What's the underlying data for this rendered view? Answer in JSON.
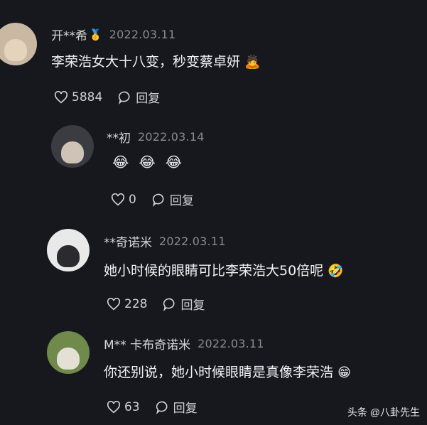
{
  "comments": [
    {
      "user": "开**希",
      "badge": "🥇",
      "date": "2022.03.11",
      "text": "李荣浩女大十八变，秒变蔡卓妍",
      "emoji": "🙇",
      "likes": "5884",
      "reply_label": "回复"
    },
    {
      "user": "**初",
      "date": "2022.03.14",
      "emojis": [
        "😂",
        "😂",
        "😂"
      ],
      "likes": "0",
      "reply_label": "回复"
    },
    {
      "user": "**奇诺米",
      "date": "2022.03.11",
      "text": "她小时候的眼睛可比李荣浩大50倍呢",
      "emoji": "🤣",
      "likes": "228",
      "reply_label": "回复"
    },
    {
      "user": "M** 卡布奇诺米",
      "date": "2022.03.11",
      "text": "你还别说，她小时候眼睛是真像李荣浩",
      "emoji": "😁",
      "likes": "63",
      "reply_label": "回复"
    }
  ],
  "watermark": "头条 @八卦先生",
  "colors": {
    "background": "#17181d",
    "date": "#8a8b92",
    "text": "#f2f2f4"
  }
}
